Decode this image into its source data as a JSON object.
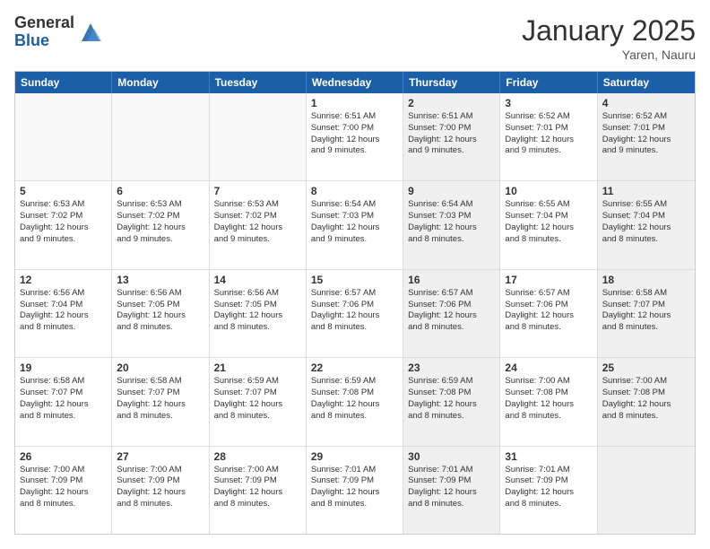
{
  "logo": {
    "general": "General",
    "blue": "Blue"
  },
  "title": "January 2025",
  "location": "Yaren, Nauru",
  "days": [
    "Sunday",
    "Monday",
    "Tuesday",
    "Wednesday",
    "Thursday",
    "Friday",
    "Saturday"
  ],
  "rows": [
    [
      {
        "day": "",
        "lines": [],
        "shaded": false,
        "empty": true
      },
      {
        "day": "",
        "lines": [],
        "shaded": false,
        "empty": true
      },
      {
        "day": "",
        "lines": [],
        "shaded": false,
        "empty": true
      },
      {
        "day": "1",
        "lines": [
          "Sunrise: 6:51 AM",
          "Sunset: 7:00 PM",
          "Daylight: 12 hours",
          "and 9 minutes."
        ],
        "shaded": false,
        "empty": false
      },
      {
        "day": "2",
        "lines": [
          "Sunrise: 6:51 AM",
          "Sunset: 7:00 PM",
          "Daylight: 12 hours",
          "and 9 minutes."
        ],
        "shaded": true,
        "empty": false
      },
      {
        "day": "3",
        "lines": [
          "Sunrise: 6:52 AM",
          "Sunset: 7:01 PM",
          "Daylight: 12 hours",
          "and 9 minutes."
        ],
        "shaded": false,
        "empty": false
      },
      {
        "day": "4",
        "lines": [
          "Sunrise: 6:52 AM",
          "Sunset: 7:01 PM",
          "Daylight: 12 hours",
          "and 9 minutes."
        ],
        "shaded": true,
        "empty": false
      }
    ],
    [
      {
        "day": "5",
        "lines": [
          "Sunrise: 6:53 AM",
          "Sunset: 7:02 PM",
          "Daylight: 12 hours",
          "and 9 minutes."
        ],
        "shaded": false,
        "empty": false
      },
      {
        "day": "6",
        "lines": [
          "Sunrise: 6:53 AM",
          "Sunset: 7:02 PM",
          "Daylight: 12 hours",
          "and 9 minutes."
        ],
        "shaded": false,
        "empty": false
      },
      {
        "day": "7",
        "lines": [
          "Sunrise: 6:53 AM",
          "Sunset: 7:02 PM",
          "Daylight: 12 hours",
          "and 9 minutes."
        ],
        "shaded": false,
        "empty": false
      },
      {
        "day": "8",
        "lines": [
          "Sunrise: 6:54 AM",
          "Sunset: 7:03 PM",
          "Daylight: 12 hours",
          "and 9 minutes."
        ],
        "shaded": false,
        "empty": false
      },
      {
        "day": "9",
        "lines": [
          "Sunrise: 6:54 AM",
          "Sunset: 7:03 PM",
          "Daylight: 12 hours",
          "and 8 minutes."
        ],
        "shaded": true,
        "empty": false
      },
      {
        "day": "10",
        "lines": [
          "Sunrise: 6:55 AM",
          "Sunset: 7:04 PM",
          "Daylight: 12 hours",
          "and 8 minutes."
        ],
        "shaded": false,
        "empty": false
      },
      {
        "day": "11",
        "lines": [
          "Sunrise: 6:55 AM",
          "Sunset: 7:04 PM",
          "Daylight: 12 hours",
          "and 8 minutes."
        ],
        "shaded": true,
        "empty": false
      }
    ],
    [
      {
        "day": "12",
        "lines": [
          "Sunrise: 6:56 AM",
          "Sunset: 7:04 PM",
          "Daylight: 12 hours",
          "and 8 minutes."
        ],
        "shaded": false,
        "empty": false
      },
      {
        "day": "13",
        "lines": [
          "Sunrise: 6:56 AM",
          "Sunset: 7:05 PM",
          "Daylight: 12 hours",
          "and 8 minutes."
        ],
        "shaded": false,
        "empty": false
      },
      {
        "day": "14",
        "lines": [
          "Sunrise: 6:56 AM",
          "Sunset: 7:05 PM",
          "Daylight: 12 hours",
          "and 8 minutes."
        ],
        "shaded": false,
        "empty": false
      },
      {
        "day": "15",
        "lines": [
          "Sunrise: 6:57 AM",
          "Sunset: 7:06 PM",
          "Daylight: 12 hours",
          "and 8 minutes."
        ],
        "shaded": false,
        "empty": false
      },
      {
        "day": "16",
        "lines": [
          "Sunrise: 6:57 AM",
          "Sunset: 7:06 PM",
          "Daylight: 12 hours",
          "and 8 minutes."
        ],
        "shaded": true,
        "empty": false
      },
      {
        "day": "17",
        "lines": [
          "Sunrise: 6:57 AM",
          "Sunset: 7:06 PM",
          "Daylight: 12 hours",
          "and 8 minutes."
        ],
        "shaded": false,
        "empty": false
      },
      {
        "day": "18",
        "lines": [
          "Sunrise: 6:58 AM",
          "Sunset: 7:07 PM",
          "Daylight: 12 hours",
          "and 8 minutes."
        ],
        "shaded": true,
        "empty": false
      }
    ],
    [
      {
        "day": "19",
        "lines": [
          "Sunrise: 6:58 AM",
          "Sunset: 7:07 PM",
          "Daylight: 12 hours",
          "and 8 minutes."
        ],
        "shaded": false,
        "empty": false
      },
      {
        "day": "20",
        "lines": [
          "Sunrise: 6:58 AM",
          "Sunset: 7:07 PM",
          "Daylight: 12 hours",
          "and 8 minutes."
        ],
        "shaded": false,
        "empty": false
      },
      {
        "day": "21",
        "lines": [
          "Sunrise: 6:59 AM",
          "Sunset: 7:07 PM",
          "Daylight: 12 hours",
          "and 8 minutes."
        ],
        "shaded": false,
        "empty": false
      },
      {
        "day": "22",
        "lines": [
          "Sunrise: 6:59 AM",
          "Sunset: 7:08 PM",
          "Daylight: 12 hours",
          "and 8 minutes."
        ],
        "shaded": false,
        "empty": false
      },
      {
        "day": "23",
        "lines": [
          "Sunrise: 6:59 AM",
          "Sunset: 7:08 PM",
          "Daylight: 12 hours",
          "and 8 minutes."
        ],
        "shaded": true,
        "empty": false
      },
      {
        "day": "24",
        "lines": [
          "Sunrise: 7:00 AM",
          "Sunset: 7:08 PM",
          "Daylight: 12 hours",
          "and 8 minutes."
        ],
        "shaded": false,
        "empty": false
      },
      {
        "day": "25",
        "lines": [
          "Sunrise: 7:00 AM",
          "Sunset: 7:08 PM",
          "Daylight: 12 hours",
          "and 8 minutes."
        ],
        "shaded": true,
        "empty": false
      }
    ],
    [
      {
        "day": "26",
        "lines": [
          "Sunrise: 7:00 AM",
          "Sunset: 7:09 PM",
          "Daylight: 12 hours",
          "and 8 minutes."
        ],
        "shaded": false,
        "empty": false
      },
      {
        "day": "27",
        "lines": [
          "Sunrise: 7:00 AM",
          "Sunset: 7:09 PM",
          "Daylight: 12 hours",
          "and 8 minutes."
        ],
        "shaded": false,
        "empty": false
      },
      {
        "day": "28",
        "lines": [
          "Sunrise: 7:00 AM",
          "Sunset: 7:09 PM",
          "Daylight: 12 hours",
          "and 8 minutes."
        ],
        "shaded": false,
        "empty": false
      },
      {
        "day": "29",
        "lines": [
          "Sunrise: 7:01 AM",
          "Sunset: 7:09 PM",
          "Daylight: 12 hours",
          "and 8 minutes."
        ],
        "shaded": false,
        "empty": false
      },
      {
        "day": "30",
        "lines": [
          "Sunrise: 7:01 AM",
          "Sunset: 7:09 PM",
          "Daylight: 12 hours",
          "and 8 minutes."
        ],
        "shaded": true,
        "empty": false
      },
      {
        "day": "31",
        "lines": [
          "Sunrise: 7:01 AM",
          "Sunset: 7:09 PM",
          "Daylight: 12 hours",
          "and 8 minutes."
        ],
        "shaded": false,
        "empty": false
      },
      {
        "day": "",
        "lines": [],
        "shaded": true,
        "empty": true
      }
    ]
  ]
}
